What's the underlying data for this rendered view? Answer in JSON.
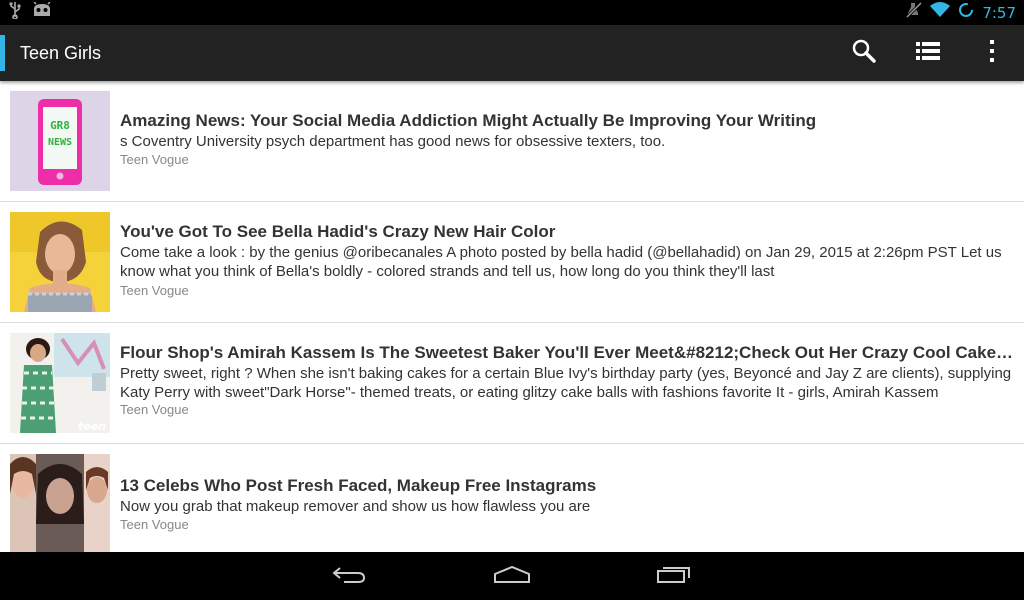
{
  "status_bar": {
    "time": "7:57",
    "icons": [
      "usb-icon",
      "android-debug-icon",
      "mute-icon",
      "wifi-icon",
      "sync-icon"
    ],
    "accent_color": "#33b5e5"
  },
  "action_bar": {
    "title": "Teen Girls",
    "actions": [
      "search-icon",
      "list-view-icon",
      "overflow-menu-icon"
    ],
    "background": "#222222"
  },
  "feed": {
    "items": [
      {
        "title": "Amazing News: Your Social Media Addiction Might Actually Be Improving Your Writing",
        "description": "s Coventry University psych department has good news for obsessive texters, too.",
        "source": "Teen Vogue",
        "thumb_text": "GR8 NEWS"
      },
      {
        "title": "You've Got To See Bella Hadid's Crazy New Hair Color",
        "description": "Come take a look : by the genius @oribecanales A photo posted by bella hadid (@bellahadid) on Jan 29, 2015 at 2:26pm PST Let us know what you think of Bella's boldly - colored strands and tell us, how long do you think they'll last",
        "source": "Teen Vogue"
      },
      {
        "title": "Flour Shop's Amirah Kassem Is The Sweetest Baker You'll Ever Meet&#8212;Check Out Her Crazy Cool Cake Creations",
        "description": "Pretty sweet, right ? When she isn't baking cakes for a certain Blue Ivy's birthday party (yes, Beyoncé and Jay Z are clients), supplying Katy Perry with sweet\"Dark Horse\"- themed treats, or eating glitzy cake balls with fashions favorite It - girls, Amirah Kassem",
        "source": "Teen Vogue",
        "thumb_text": "teen"
      },
      {
        "title": "13 Celebs Who Post Fresh Faced, Makeup Free Instagrams",
        "description": "Now you grab that makeup remover and show us how flawless you are",
        "source": "Teen Vogue"
      }
    ]
  },
  "nav_bar": {
    "buttons": [
      "back-icon",
      "home-icon",
      "recent-apps-icon"
    ]
  }
}
